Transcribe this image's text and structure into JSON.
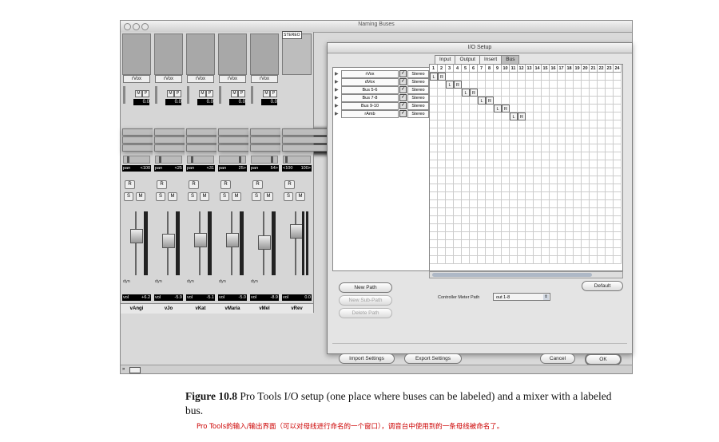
{
  "window": {
    "title": "Naming Buses"
  },
  "mixer": {
    "channels": [
      {
        "name": "rVox",
        "trim_value": "0.0",
        "input": "no input",
        "output": "St Out",
        "automation": "auto read",
        "pan_label": "pan",
        "pan_value": "<100",
        "rec": "R",
        "solo": "S",
        "mute": "M",
        "dyn": "dyn",
        "vol_label": "vol",
        "vol_value": "+6.2",
        "track": "vAngi",
        "fader_level": 0.62
      },
      {
        "name": "rVox",
        "trim_value": "0.0",
        "input": "no input",
        "output": "St Out",
        "automation": "auto read",
        "pan_label": "pan",
        "pan_value": "<25",
        "rec": "R",
        "solo": "S",
        "mute": "M",
        "dyn": "dyn",
        "vol_label": "vol",
        "vol_value": "-5.9",
        "track": "vJo",
        "fader_level": 0.55
      },
      {
        "name": "rVox",
        "trim_value": "0.0",
        "input": "no input",
        "output": "St Out",
        "automation": "auto read",
        "pan_label": "pan",
        "pan_value": "<31",
        "rec": "R",
        "solo": "S",
        "mute": "M",
        "dyn": "dyn",
        "vol_label": "vol",
        "vol_value": "-5.1",
        "track": "vKat",
        "fader_level": 0.56
      },
      {
        "name": "rVox",
        "trim_value": "0.0",
        "input": "no input",
        "output": "St Out",
        "automation": "auto read",
        "pan_label": "pan",
        "pan_value": "25>",
        "rec": "R",
        "solo": "S",
        "mute": "M",
        "dyn": "dyn",
        "vol_label": "vol",
        "vol_value": "-5.0",
        "track": "vMaria",
        "fader_level": 0.56
      },
      {
        "name": "rVox",
        "trim_value": "0.0",
        "input": "no input",
        "output": "St Out",
        "automation": "auto read",
        "pan_label": "pan",
        "pan_value": "54>",
        "rec": "R",
        "solo": "S",
        "mute": "M",
        "dyn": "dyn",
        "vol_label": "vol",
        "vol_value": "-8.9",
        "track": "vMel",
        "fader_level": 0.52
      }
    ],
    "aux": {
      "badge": "STEREO",
      "name": "rVox",
      "input": "rVox",
      "output": "St Out",
      "automation": "auto read",
      "pan_left": "<100",
      "pan_right": "100>",
      "rec": "R",
      "solo": "S",
      "mute": "M",
      "vol_label": "vol",
      "vol_value": "0.0",
      "track": "vRev",
      "fader_level": 0.7
    }
  },
  "io_setup": {
    "title": "I/O Setup",
    "tabs": [
      "Input",
      "Output",
      "Insert",
      "Bus"
    ],
    "selected_tab": "Bus",
    "columns": [
      "1",
      "2",
      "3",
      "4",
      "5",
      "6",
      "7",
      "8",
      "9",
      "10",
      "11",
      "12",
      "13",
      "14",
      "15",
      "16",
      "17",
      "18",
      "19",
      "20",
      "21",
      "22",
      "23",
      "24"
    ],
    "paths": [
      {
        "name": "rVox",
        "format": "Stereo",
        "assign": [
          "L",
          "R"
        ],
        "start": 0
      },
      {
        "name": "dVox",
        "format": "Stereo",
        "assign": [
          "L",
          "R"
        ],
        "start": 2
      },
      {
        "name": "Bus 5-6",
        "format": "Stereo",
        "assign": [
          "L",
          "R"
        ],
        "start": 4
      },
      {
        "name": "Bus 7-8",
        "format": "Stereo",
        "assign": [
          "L",
          "R"
        ],
        "start": 6
      },
      {
        "name": "Bus 9-10",
        "format": "Stereo",
        "assign": [
          "L",
          "R"
        ],
        "start": 8
      },
      {
        "name": "rAmb",
        "format": "Stereo",
        "assign": [
          "L",
          "R"
        ],
        "start": 10
      }
    ],
    "buttons": {
      "new_path": "New Path",
      "new_sub_path": "New Sub-Path",
      "delete_path": "Delete Path",
      "default": "Default",
      "import": "Import Settings",
      "export": "Export Settings",
      "cancel": "Cancel",
      "ok": "OK"
    },
    "controller_label": "Controller Meter Path",
    "controller_value": "out 1-8"
  },
  "caption": {
    "figure": "Figure 10.8",
    "text": "Pro Tools I/O setup (one place where buses can be labeled) and a mixer with a labeled bus.",
    "chinese": "Pro Tools的输入/输出界面（可以对母线进行命名的一个窗口），调音台中使用到的一条母线被命名了。"
  }
}
